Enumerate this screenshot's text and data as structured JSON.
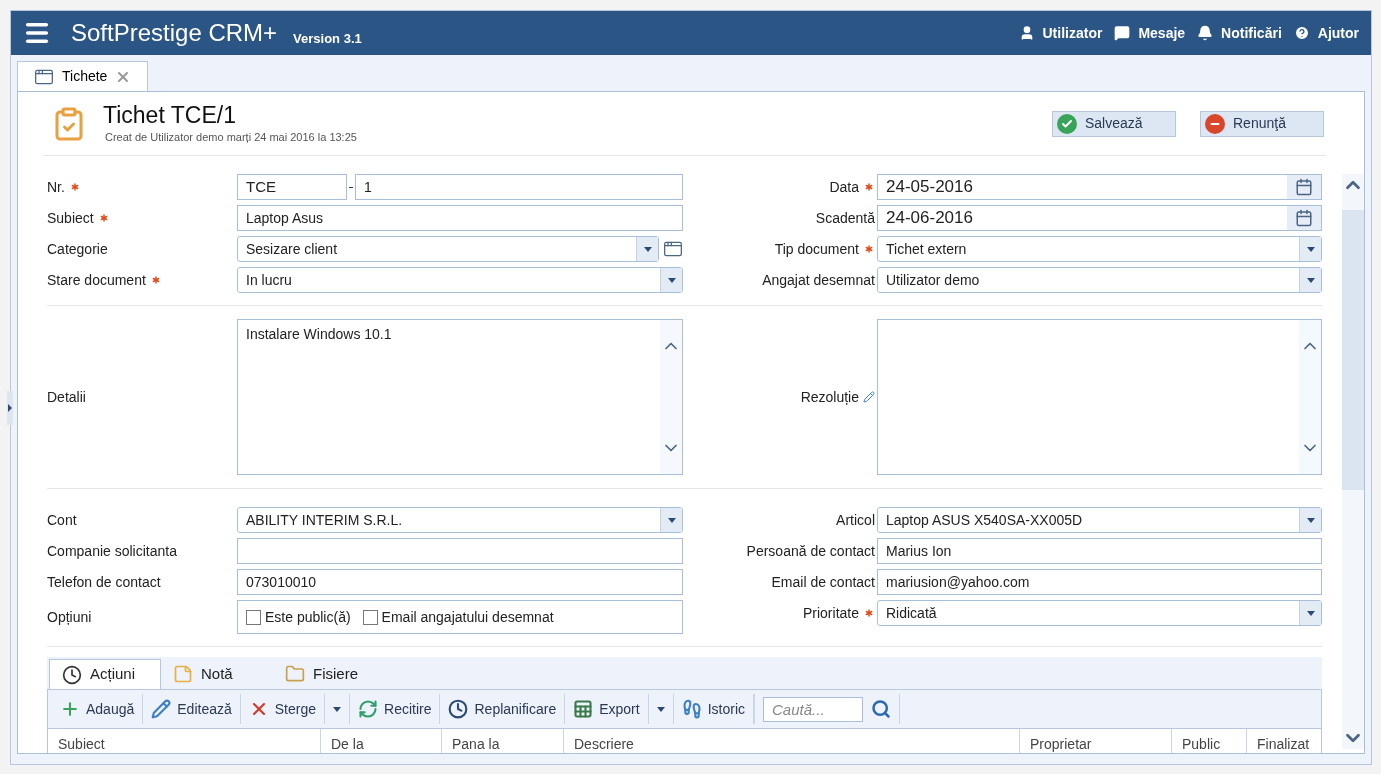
{
  "header": {
    "app_name": "SoftPrestige CRM+",
    "version": "Version 3.1",
    "links": [
      {
        "kind": "user",
        "label": "Utilizator"
      },
      {
        "kind": "messages",
        "label": "Mesaje"
      },
      {
        "kind": "notifications",
        "label": "Notificări"
      },
      {
        "kind": "help",
        "label": "Ajutor"
      }
    ]
  },
  "tabs": [
    {
      "label": "Tichete",
      "selected": true
    }
  ],
  "form": {
    "title": "Tichet TCE/1",
    "subtitle": "Creat de Utilizator demo marți 24 mai 2016 la 13:25",
    "buttons": [
      {
        "kind": "save",
        "label": "Salvează"
      },
      {
        "kind": "cancel",
        "label": "Renunţă"
      }
    ]
  },
  "sections": [
    {
      "left": [
        {
          "kind": "number",
          "label": "Nr.",
          "required": true,
          "prefix": "TCE",
          "value": "1"
        },
        {
          "kind": "text",
          "label": "Subiect",
          "required": true,
          "value": "Laptop Asus"
        },
        {
          "kind": "select",
          "label": "Categorie",
          "required": false,
          "value": "Sesizare client",
          "browse": true
        },
        {
          "kind": "select",
          "label": "Stare document",
          "required": true,
          "value": "In lucru",
          "browse": false
        }
      ],
      "right": [
        {
          "kind": "date",
          "label": "Data",
          "required": true,
          "value": "24-05-2016"
        },
        {
          "kind": "date",
          "label": "Scadentă",
          "required": false,
          "value": "24-06-2016"
        },
        {
          "kind": "select",
          "label": "Tip document",
          "required": true,
          "value": "Tichet extern",
          "browse": false
        },
        {
          "kind": "select",
          "label": "Angajat desemnat",
          "required": false,
          "value": "Utilizator demo",
          "browse": false
        }
      ]
    },
    {
      "left": [
        {
          "kind": "textarea",
          "label": "Detalii",
          "editable": false,
          "value": "Instalare Windows 10.1"
        }
      ],
      "right": [
        {
          "kind": "textarea",
          "label": "Rezoluție",
          "editable": true
        }
      ]
    },
    {
      "left": [
        {
          "kind": "select",
          "label": "Cont",
          "required": false,
          "value": "ABILITY INTERIM S.R.L.",
          "browse": false
        },
        {
          "kind": "text",
          "label": "Companie solicitanta",
          "required": false
        },
        {
          "kind": "text",
          "label": "Telefon de contact",
          "required": false,
          "value": "073010010"
        },
        {
          "kind": "checkboxes",
          "label": "Opțiuni",
          "required": false,
          "options": [
            {
              "label": "Este public(ă)",
              "checked": false
            },
            {
              "label": "Email angajatului desemnat",
              "checked": false
            }
          ]
        }
      ],
      "right": [
        {
          "kind": "select",
          "label": "Articol",
          "required": false,
          "value": "Laptop ASUS X540SA-XX005D",
          "browse": false
        },
        {
          "kind": "text",
          "label": "Persoană de contact",
          "required": false,
          "value": "Marius Ion"
        },
        {
          "kind": "text",
          "label": "Email de contact",
          "required": false,
          "value": "mariusion@yahoo.com"
        },
        {
          "kind": "select",
          "label": "Prioritate",
          "required": true,
          "value": "Ridicată",
          "browse": false
        }
      ]
    }
  ],
  "detail_tabs": [
    {
      "kind": "actions",
      "label": "Acțiuni",
      "selected": true
    },
    {
      "kind": "note",
      "label": "Notă",
      "selected": false
    },
    {
      "kind": "files",
      "label": "Fisiere",
      "selected": false
    }
  ],
  "toolbar": [
    {
      "kind": "add",
      "label": "Adaugă",
      "dropdown": false
    },
    {
      "kind": "edit",
      "label": "Editează",
      "dropdown": false
    },
    {
      "kind": "delete",
      "label": "Sterge",
      "dropdown": true
    },
    {
      "kind": "reload",
      "label": "Recitire",
      "dropdown": false
    },
    {
      "kind": "reschedule",
      "label": "Replanificare",
      "dropdown": false
    },
    {
      "kind": "export",
      "label": "Export",
      "dropdown": true
    },
    {
      "kind": "history",
      "label": "Istoric",
      "dropdown": false
    },
    {
      "kind": "search",
      "placeholder": "Caută..."
    }
  ],
  "table": {
    "columns": [
      "Subiect",
      "De la",
      "Pana la",
      "Descriere",
      "Proprietar",
      "Public",
      "Finalizat"
    ]
  }
}
